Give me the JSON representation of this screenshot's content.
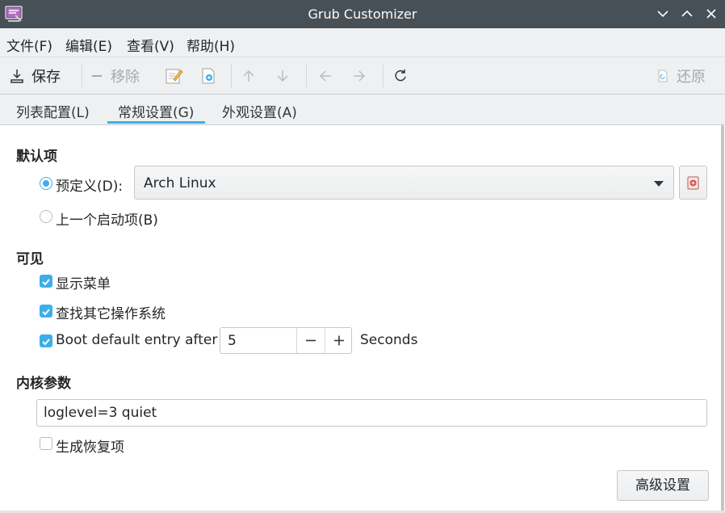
{
  "window": {
    "title": "Grub Customizer"
  },
  "menubar": {
    "items": [
      "文件(F)",
      "编辑(E)",
      "查看(V)",
      "帮助(H)"
    ]
  },
  "toolbar": {
    "save_label": "保存",
    "remove_label": "移除",
    "revert_label": "还原"
  },
  "tabs": {
    "items": [
      "列表配置(L)",
      "常规设置(G)",
      "外观设置(A)"
    ],
    "active": "常规设置(G)"
  },
  "default_entry": {
    "section_title": "默认项",
    "predefined_label": "预定义(D):",
    "predefined_value": "Arch Linux",
    "predefined_checked": true,
    "previous_label": "上一个启动项(B)",
    "previous_checked": false
  },
  "visibility": {
    "section_title": "可见",
    "show_menu_label": "显示菜单",
    "show_menu_checked": true,
    "os_prober_label": "查找其它操作系统",
    "os_prober_checked": true,
    "timeout_label": "Boot default entry after",
    "timeout_checked": true,
    "timeout_value": "5",
    "timeout_unit": "Seconds"
  },
  "kernel": {
    "section_title": "内核参数",
    "params_value": "loglevel=3 quiet",
    "recovery_label": "生成恢复项",
    "recovery_checked": false
  },
  "advanced_button_label": "高级设置",
  "colors": {
    "titlebar": "#475057",
    "accent": "#3daee9",
    "chrome": "#eff0f1",
    "text": "#232629"
  },
  "icons": {
    "app": "grub-customizer-icon",
    "save": "save-icon",
    "remove": "minus-icon",
    "edit": "edit-icon",
    "new": "new-entry-icon",
    "up": "arrow-up-icon",
    "down": "arrow-down-icon",
    "left": "arrow-left-icon",
    "right": "arrow-right-icon",
    "reload": "reload-icon",
    "revert": "revert-icon"
  }
}
